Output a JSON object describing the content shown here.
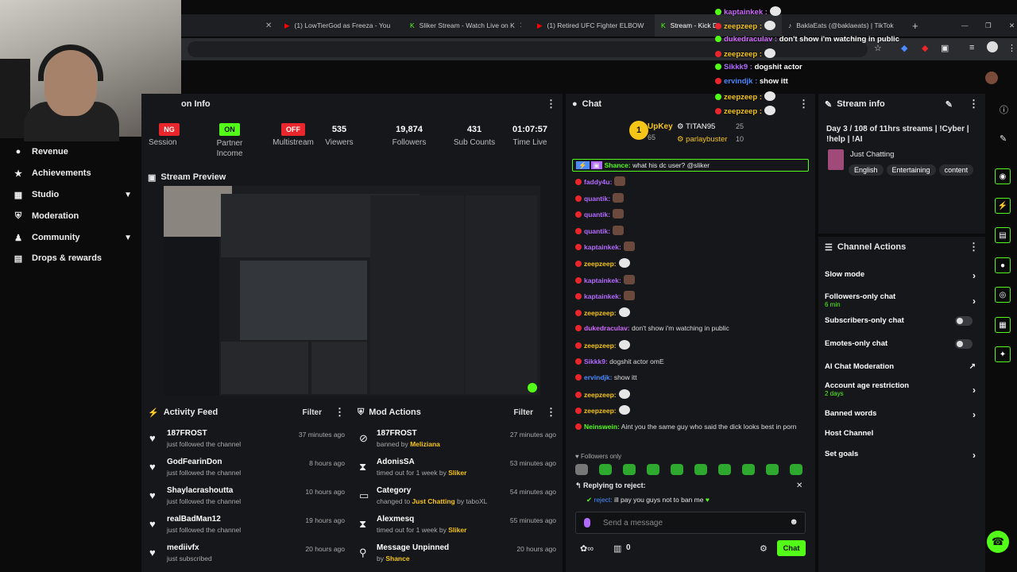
{
  "browser": {
    "tabs": [
      {
        "label": "(1) LowTierGod as Freeza - You"
      },
      {
        "label": "Sliker Stream - Watch Live on K"
      },
      {
        "label": "(1) Retired UFC Fighter ELBOW"
      },
      {
        "label": "Stream - Kick D"
      },
      {
        "label": "BaklaEats (@baklaeats) | TikTok"
      }
    ],
    "new_tab": "+"
  },
  "sidebar": {
    "items": [
      {
        "label": "Revenue",
        "icon": "dollar-icon"
      },
      {
        "label": "Achievements",
        "icon": "trophy-icon"
      },
      {
        "label": "Studio",
        "icon": "studio-icon"
      },
      {
        "label": "Moderation",
        "icon": "shield-icon"
      },
      {
        "label": "Community",
        "icon": "community-icon"
      },
      {
        "label": "Drops & rewards",
        "icon": "gift-icon"
      }
    ]
  },
  "session": {
    "title": "on Info",
    "stats": [
      {
        "value": "NG",
        "label": "Session",
        "badge_color": "#e8262b"
      },
      {
        "value": "ON",
        "label": "Partner Income",
        "badge_color": "#53fc18"
      },
      {
        "value": "OFF",
        "label": "Multistream",
        "badge_color": "#e8262b"
      },
      {
        "value": "535",
        "label": "Viewers"
      },
      {
        "value": "19,874",
        "label": "Followers"
      },
      {
        "value": "431",
        "label": "Sub Counts"
      },
      {
        "value": "01:07:57",
        "label": "Time Live"
      }
    ]
  },
  "preview": {
    "title": "Stream Preview"
  },
  "activity": {
    "title": "Activity Feed",
    "filter": "Filter",
    "items": [
      {
        "name": "187FROST",
        "sub": "just followed the channel",
        "time": "37 minutes ago"
      },
      {
        "name": "GodFearinDon",
        "sub": "just followed the channel",
        "time": "8 hours ago"
      },
      {
        "name": "Shaylacrashoutta",
        "sub": "just followed the channel",
        "time": "10 hours ago"
      },
      {
        "name": "realBadMan12",
        "sub": "just followed the channel",
        "time": "19 hours ago"
      },
      {
        "name": "mediivfx",
        "sub": "just subscribed",
        "time": "20 hours ago"
      }
    ]
  },
  "mod": {
    "title": "Mod Actions",
    "filter": "Filter",
    "items": [
      {
        "name": "187FROST",
        "pre": "banned by ",
        "actor": "Meliziana",
        "post": "",
        "time": "27 minutes ago",
        "icon": "ban-icon"
      },
      {
        "name": "AdonisSA",
        "pre": "timed out for 1 week by ",
        "actor": "Sliker",
        "post": "",
        "time": "53 minutes ago",
        "icon": "hourglass-icon"
      },
      {
        "name": "Category",
        "pre": "changed to ",
        "actor": "Just Chatting",
        "post": " by taboXL",
        "time": "54 minutes ago",
        "icon": "category-icon"
      },
      {
        "name": "Alexmesq",
        "pre": "timed out for 1 week by ",
        "actor": "Sliker",
        "post": "",
        "time": "55 minutes ago",
        "icon": "hourglass-icon"
      },
      {
        "name": "Message Unpinned",
        "pre": "by ",
        "actor": "Shance",
        "post": "",
        "time": "20 hours ago",
        "icon": "pin-icon"
      }
    ]
  },
  "chat": {
    "title": "Chat",
    "leaderboard": {
      "top": {
        "name": "UpKey",
        "count": "65",
        "rank": "1"
      },
      "second": {
        "name": "TITAN95",
        "count": "25"
      },
      "third": {
        "name": "parlaybuster",
        "count": "10"
      }
    },
    "pinned": {
      "user": "Shance:",
      "text": "what his dc user? @sliker"
    },
    "messages": [
      {
        "user": "faddy4u:",
        "color": "#b36bff",
        "text": "",
        "emote": true
      },
      {
        "user": "quantik:",
        "color": "#b36bff",
        "text": "",
        "emote": true
      },
      {
        "user": "quantik:",
        "color": "#b36bff",
        "text": "",
        "emote": true
      },
      {
        "user": "quantik:",
        "color": "#b36bff",
        "text": "",
        "emote": true
      },
      {
        "user": "kaptainkek:",
        "color": "#b36bff",
        "text": "",
        "emote": true
      },
      {
        "user": "zeepzeep:",
        "color": "#f5c518",
        "text": "",
        "emote": false
      },
      {
        "user": "kaptainkek:",
        "color": "#b36bff",
        "text": "",
        "emote": true
      },
      {
        "user": "kaptainkek:",
        "color": "#b36bff",
        "text": "",
        "emote": true
      },
      {
        "user": "zeepzeep:",
        "color": "#f5c518",
        "text": "",
        "emote": false
      },
      {
        "user": "dukedraculav:",
        "color": "#d16bff",
        "text": "don't show i'm watching in public",
        "emote": false
      },
      {
        "user": "zeepzeep:",
        "color": "#f5c518",
        "text": "",
        "emote": false
      },
      {
        "user": "Sikkk9:",
        "color": "#b36bff",
        "text": "dogshit actor omE",
        "emote": false
      },
      {
        "user": "ervindjk:",
        "color": "#4a8cff",
        "text": "show itt",
        "emote": false
      },
      {
        "user": "zeepzeep:",
        "color": "#f5c518",
        "text": "",
        "emote": false
      },
      {
        "user": "zeepzeep:",
        "color": "#f5c518",
        "text": "",
        "emote": false
      },
      {
        "user": "Neinswein:",
        "color": "#53fc18",
        "text": "Aint you the same guy who said the dick looks best in porn",
        "emote": false
      }
    ],
    "followers_only": "Followers only",
    "reply": {
      "title": "Replying to reject:",
      "user": "reject:",
      "text": "ill pay you guys not to ban me"
    },
    "input_placeholder": "Send a message",
    "count": "0",
    "send": "Chat"
  },
  "streaminfo": {
    "title": "Stream info",
    "text": "Day 3 / 108 of 11hrs streams | !Cyber | !help | !AI",
    "category": "Just Chatting",
    "tags": [
      "English",
      "Entertaining",
      "content"
    ]
  },
  "actions": {
    "title": "Channel Actions",
    "items": [
      {
        "label": "Slow mode",
        "sub": "",
        "ctrl": "arrow"
      },
      {
        "label": "Followers-only chat",
        "sub": "6 min",
        "ctrl": "arrow"
      },
      {
        "label": "Subscribers-only chat",
        "sub": "",
        "ctrl": "toggle"
      },
      {
        "label": "Emotes-only chat",
        "sub": "",
        "ctrl": "toggle"
      },
      {
        "label": "AI Chat Moderation",
        "sub": "",
        "ctrl": "chart"
      },
      {
        "label": "Account age restriction",
        "sub": "2 days",
        "ctrl": "arrow"
      },
      {
        "label": "Banned words",
        "sub": "",
        "ctrl": "arrow"
      },
      {
        "label": "Host Channel",
        "sub": "",
        "ctrl": "none"
      },
      {
        "label": "Set goals",
        "sub": "",
        "ctrl": "arrow"
      }
    ]
  },
  "overlay_chat": [
    {
      "user": "kaptainkek :",
      "text": "",
      "color": "#d16bff"
    },
    {
      "user": "zeepzeep :",
      "text": "",
      "color": "#f5c518"
    },
    {
      "user": "dukedraculav :",
      "text": "don't show i'm watching in public",
      "color": "#d16bff"
    },
    {
      "user": "zeepzeep :",
      "text": "",
      "color": "#f5c518"
    },
    {
      "user": "Sikkk9 :",
      "text": "dogshit actor",
      "color": "#b36bff"
    },
    {
      "user": "ervindjk :",
      "text": "show itt",
      "color": "#4a8cff"
    },
    {
      "user": "zeepzeep :",
      "text": "",
      "color": "#f5c518"
    },
    {
      "user": "zeepzeep :",
      "text": "",
      "color": "#f5c518"
    }
  ]
}
